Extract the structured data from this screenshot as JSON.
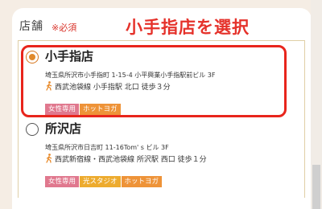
{
  "field": {
    "label": "店舗",
    "required": "※必須"
  },
  "annotation": {
    "banner": "小手指店を選択",
    "color": "#e8251c"
  },
  "stores": [
    {
      "name": "小手指店",
      "selected": true,
      "address": "埼玉県所沢市小手指町 1-15-4 小平興業小手指駅前ビル 3F",
      "access": "西武池袋線 小手指駅 北口 徒歩３分",
      "tags": [
        "女性専用",
        "ホットヨガ"
      ]
    },
    {
      "name": "所沢店",
      "selected": false,
      "address": "埼玉県所沢市日吉町 11-16Tom' s ビル 3F",
      "access": "西武新宿線・西武池袋線 所沢駅 西口 徒歩１分",
      "tags": [
        "女性専用",
        "光スタジオ",
        "ホットヨガ"
      ]
    }
  ],
  "colors": {
    "tag_pink": "#e0788e",
    "tag_orange": "#ee9338",
    "tag_yellow": "#edab2e",
    "radio_selected": "#e08a2d"
  },
  "icons": {
    "access": "walking-person-icon"
  }
}
